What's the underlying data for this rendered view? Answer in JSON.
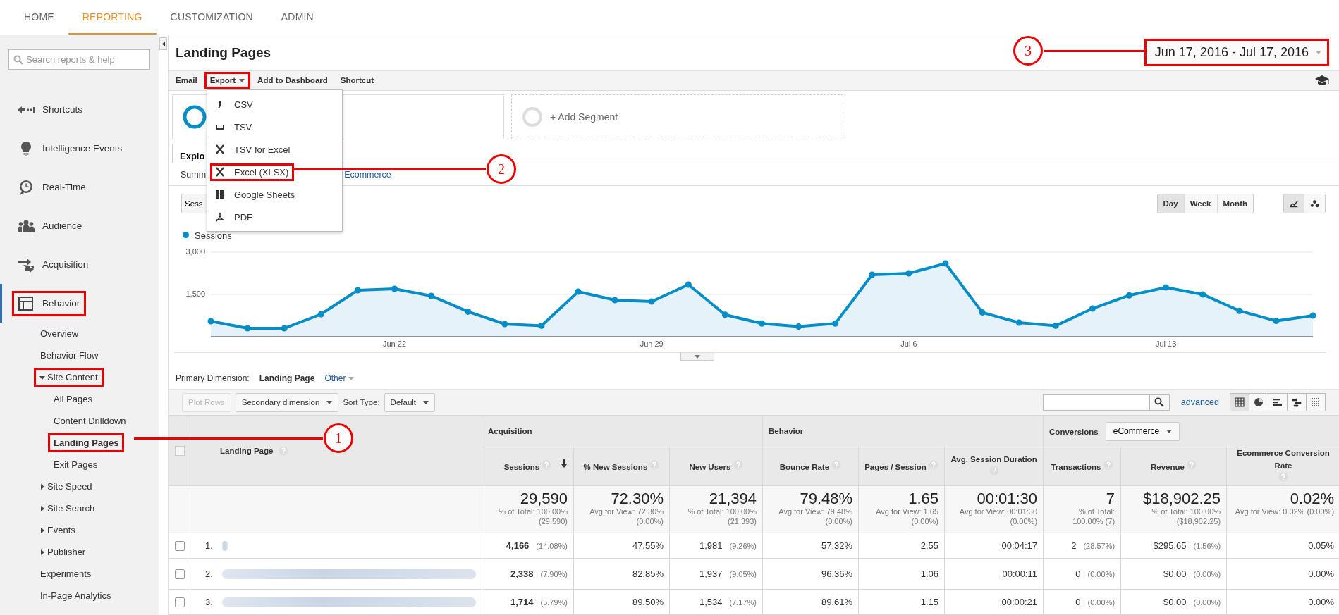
{
  "top_nav": {
    "tabs": [
      {
        "label": "HOME",
        "selected": false
      },
      {
        "label": "REPORTING",
        "selected": true
      },
      {
        "label": "CUSTOMIZATION",
        "selected": false
      },
      {
        "label": "ADMIN",
        "selected": false
      }
    ]
  },
  "sidebar": {
    "search": {
      "placeholder": "Search reports & help"
    },
    "items": [
      {
        "label": "Shortcuts",
        "selected": false,
        "highlighted": false
      },
      {
        "label": "Intelligence Events",
        "selected": false,
        "highlighted": false
      },
      {
        "label": "Real-Time",
        "selected": false,
        "highlighted": false
      },
      {
        "label": "Audience",
        "selected": false,
        "highlighted": false
      },
      {
        "label": "Acquisition",
        "selected": false,
        "highlighted": false
      },
      {
        "label": "Behavior",
        "selected": true,
        "highlighted": true,
        "children": [
          {
            "label": "Overview",
            "selected": false,
            "highlighted": false
          },
          {
            "label": "Behavior Flow",
            "selected": false,
            "highlighted": false
          },
          {
            "label": "Site Content",
            "selected": false,
            "highlighted": true,
            "expanded": true,
            "children": [
              {
                "label": "All Pages",
                "selected": false,
                "highlighted": false
              },
              {
                "label": "Content Drilldown",
                "selected": false,
                "highlighted": false
              },
              {
                "label": "Landing Pages",
                "selected": true,
                "highlighted": true
              },
              {
                "label": "Exit Pages",
                "selected": false,
                "highlighted": false
              }
            ]
          },
          {
            "label": "Site Speed",
            "selected": false,
            "highlighted": false,
            "expanded": false
          },
          {
            "label": "Site Search",
            "selected": false,
            "highlighted": false,
            "expanded": false
          },
          {
            "label": "Events",
            "selected": false,
            "highlighted": false,
            "expanded": false
          },
          {
            "label": "Publisher",
            "selected": false,
            "highlighted": false,
            "expanded": false
          },
          {
            "label": "Experiments",
            "selected": false,
            "highlighted": false
          },
          {
            "label": "In-Page Analytics",
            "selected": false,
            "highlighted": false
          }
        ]
      }
    ]
  },
  "report": {
    "title": "Landing Pages",
    "date_range": {
      "text": "Jun 17, 2016 - Jul 17, 2016",
      "highlighted": true
    },
    "toolbar": [
      {
        "label": "Email",
        "kind": "action",
        "highlighted": false
      },
      {
        "label": "Export",
        "kind": "menu",
        "highlighted": true
      },
      {
        "label": "Add to Dashboard",
        "kind": "action",
        "highlighted": false
      },
      {
        "label": "Shortcut",
        "kind": "action",
        "highlighted": false
      }
    ],
    "export_menu": [
      {
        "label": "CSV",
        "highlighted": false
      },
      {
        "label": "TSV",
        "highlighted": false
      },
      {
        "label": "TSV for Excel",
        "highlighted": false
      },
      {
        "label": "Excel (XLSX)",
        "highlighted": true
      },
      {
        "label": "Google Sheets",
        "highlighted": false
      },
      {
        "label": "PDF",
        "highlighted": false
      }
    ],
    "segments": [
      {
        "kind": "active"
      },
      {
        "kind": "add",
        "label": "+ Add Segment"
      }
    ],
    "tabs": [
      {
        "label": "Explo",
        "selected": true
      }
    ],
    "subtabs": [
      {
        "label": "Summ",
        "selected": true
      },
      {
        "label": "Ecommerce",
        "selected": false
      }
    ],
    "chart_controls": {
      "metric": "Sess",
      "intervals": [
        {
          "label": "Day",
          "selected": true
        },
        {
          "label": "Week",
          "selected": false
        },
        {
          "label": "Month",
          "selected": false
        }
      ],
      "chart_types": [
        {
          "selected": true
        },
        {
          "selected": false
        }
      ]
    },
    "x_axis_labels": [
      {
        "label": "Jun 22"
      },
      {
        "label": "Jun 29"
      },
      {
        "label": "Jul 6"
      },
      {
        "label": "Jul 13"
      }
    ],
    "chart_data": {
      "type": "area",
      "series": [
        {
          "name": "Sessions",
          "color": "#058dc7",
          "values": [
            550,
            300,
            300,
            800,
            1650,
            1700,
            1450,
            890,
            450,
            390,
            1600,
            1300,
            1250,
            1850,
            780,
            470,
            360,
            470,
            2200,
            2250,
            2600,
            860,
            500,
            390,
            1000,
            1470,
            1750,
            1500,
            920,
            560,
            750
          ]
        }
      ],
      "ylim": [
        0,
        3000
      ],
      "yticks": [
        {
          "value": 1500,
          "label": "1,500"
        },
        {
          "value": 3000,
          "label": "3,000"
        }
      ]
    },
    "primary_dimension": {
      "label": "Primary Dimension:",
      "options": [
        {
          "label": "Landing Page",
          "kind": "option",
          "selected": true
        },
        {
          "label": "Other",
          "kind": "menu",
          "selected": false
        }
      ]
    },
    "table_toolbar": {
      "plot_rows": {
        "label": "Plot Rows",
        "disabled": true
      },
      "secondary_dimension": "Secondary dimension",
      "sort_type_label": "Sort Type:",
      "sort_type": "Default",
      "advanced": "advanced",
      "views": [
        {
          "selected": true
        },
        {
          "selected": false
        },
        {
          "selected": false
        },
        {
          "selected": false
        },
        {
          "selected": false
        }
      ]
    },
    "table": {
      "select_all": {
        "checked": false
      },
      "first_column": "Landing Page",
      "column_groups": [
        {
          "label": "Acquisition"
        },
        {
          "label": "Behavior"
        },
        {
          "label": "Conversions",
          "selector": "eCommerce"
        }
      ],
      "columns": [
        {
          "label": "Sessions",
          "sorted": true
        },
        {
          "label": "% New Sessions",
          "sorted": false
        },
        {
          "label": "New Users",
          "sorted": false
        },
        {
          "label": "Bounce Rate",
          "sorted": false
        },
        {
          "label": "Pages / Session",
          "sorted": false
        },
        {
          "label": "Avg. Session Duration",
          "sorted": false
        },
        {
          "label": "Transactions",
          "sorted": false
        },
        {
          "label": "Revenue",
          "sorted": false
        },
        {
          "label": "Ecommerce Conversion Rate",
          "sorted": false
        }
      ],
      "totals": [
        {
          "value": "29,590",
          "detail": [
            "% of Total: 100.00%",
            "(29,590)"
          ]
        },
        {
          "value": "72.30%",
          "detail": [
            "Avg for View: 72.30%",
            "(0.00%)"
          ]
        },
        {
          "value": "21,394",
          "detail": [
            "% of Total: 100.00%",
            "(21,393)"
          ]
        },
        {
          "value": "79.48%",
          "detail": [
            "Avg for View: 79.48%",
            "(0.00%)"
          ]
        },
        {
          "value": "1.65",
          "detail": [
            "Avg for View: 1.65",
            "(0.00%)"
          ]
        },
        {
          "value": "00:01:30",
          "detail": [
            "Avg for View: 00:01:30",
            "(0.00%)"
          ]
        },
        {
          "value": "7",
          "detail": [
            "% of Total:",
            "100.00% (7)"
          ]
        },
        {
          "value": "$18,902.25",
          "detail": [
            "% of Total: 100.00%",
            "($18,902.25)"
          ]
        },
        {
          "value": "0.02%",
          "detail": [
            "Avg for View: 0.02% (0.00%)"
          ]
        }
      ],
      "rows": [
        {
          "index": "1.",
          "checked": false,
          "page": {
            "kind": "blurred"
          },
          "cells": [
            {
              "value": "4,166",
              "share": "(14.08%)"
            },
            {
              "value": "47.55%"
            },
            {
              "value": "1,981",
              "share": "(9.26%)"
            },
            {
              "value": "57.32%"
            },
            {
              "value": "2.55"
            },
            {
              "value": "00:04:17"
            },
            {
              "value": "2",
              "share": "(28.57%)"
            },
            {
              "value": "$295.65",
              "share": "(1.56%)"
            },
            {
              "value": "0.05%"
            }
          ]
        },
        {
          "index": "2.",
          "checked": false,
          "page": {
            "kind": "blurred"
          },
          "cells": [
            {
              "value": "2,338",
              "share": "(7.90%)"
            },
            {
              "value": "82.85%"
            },
            {
              "value": "1,937",
              "share": "(9.05%)"
            },
            {
              "value": "96.36%"
            },
            {
              "value": "1.06"
            },
            {
              "value": "00:00:11"
            },
            {
              "value": "0",
              "share": "(0.00%)"
            },
            {
              "value": "$0.00",
              "share": "(0.00%)"
            },
            {
              "value": "0.00%"
            }
          ]
        },
        {
          "index": "3.",
          "checked": false,
          "page": {
            "kind": "blurred"
          },
          "cells": [
            {
              "value": "1,714",
              "share": "(5.79%)"
            },
            {
              "value": "89.50%"
            },
            {
              "value": "1,534",
              "share": "(7.17%)"
            },
            {
              "value": "89.61%"
            },
            {
              "value": "1.15"
            },
            {
              "value": "00:00:21"
            },
            {
              "value": "0",
              "share": "(0.00%)"
            },
            {
              "value": "$0.00",
              "share": "(0.00%)"
            },
            {
              "value": "0.00%"
            }
          ]
        }
      ]
    }
  },
  "annotations": [
    {
      "label": "1"
    },
    {
      "label": "2"
    },
    {
      "label": "3"
    }
  ]
}
